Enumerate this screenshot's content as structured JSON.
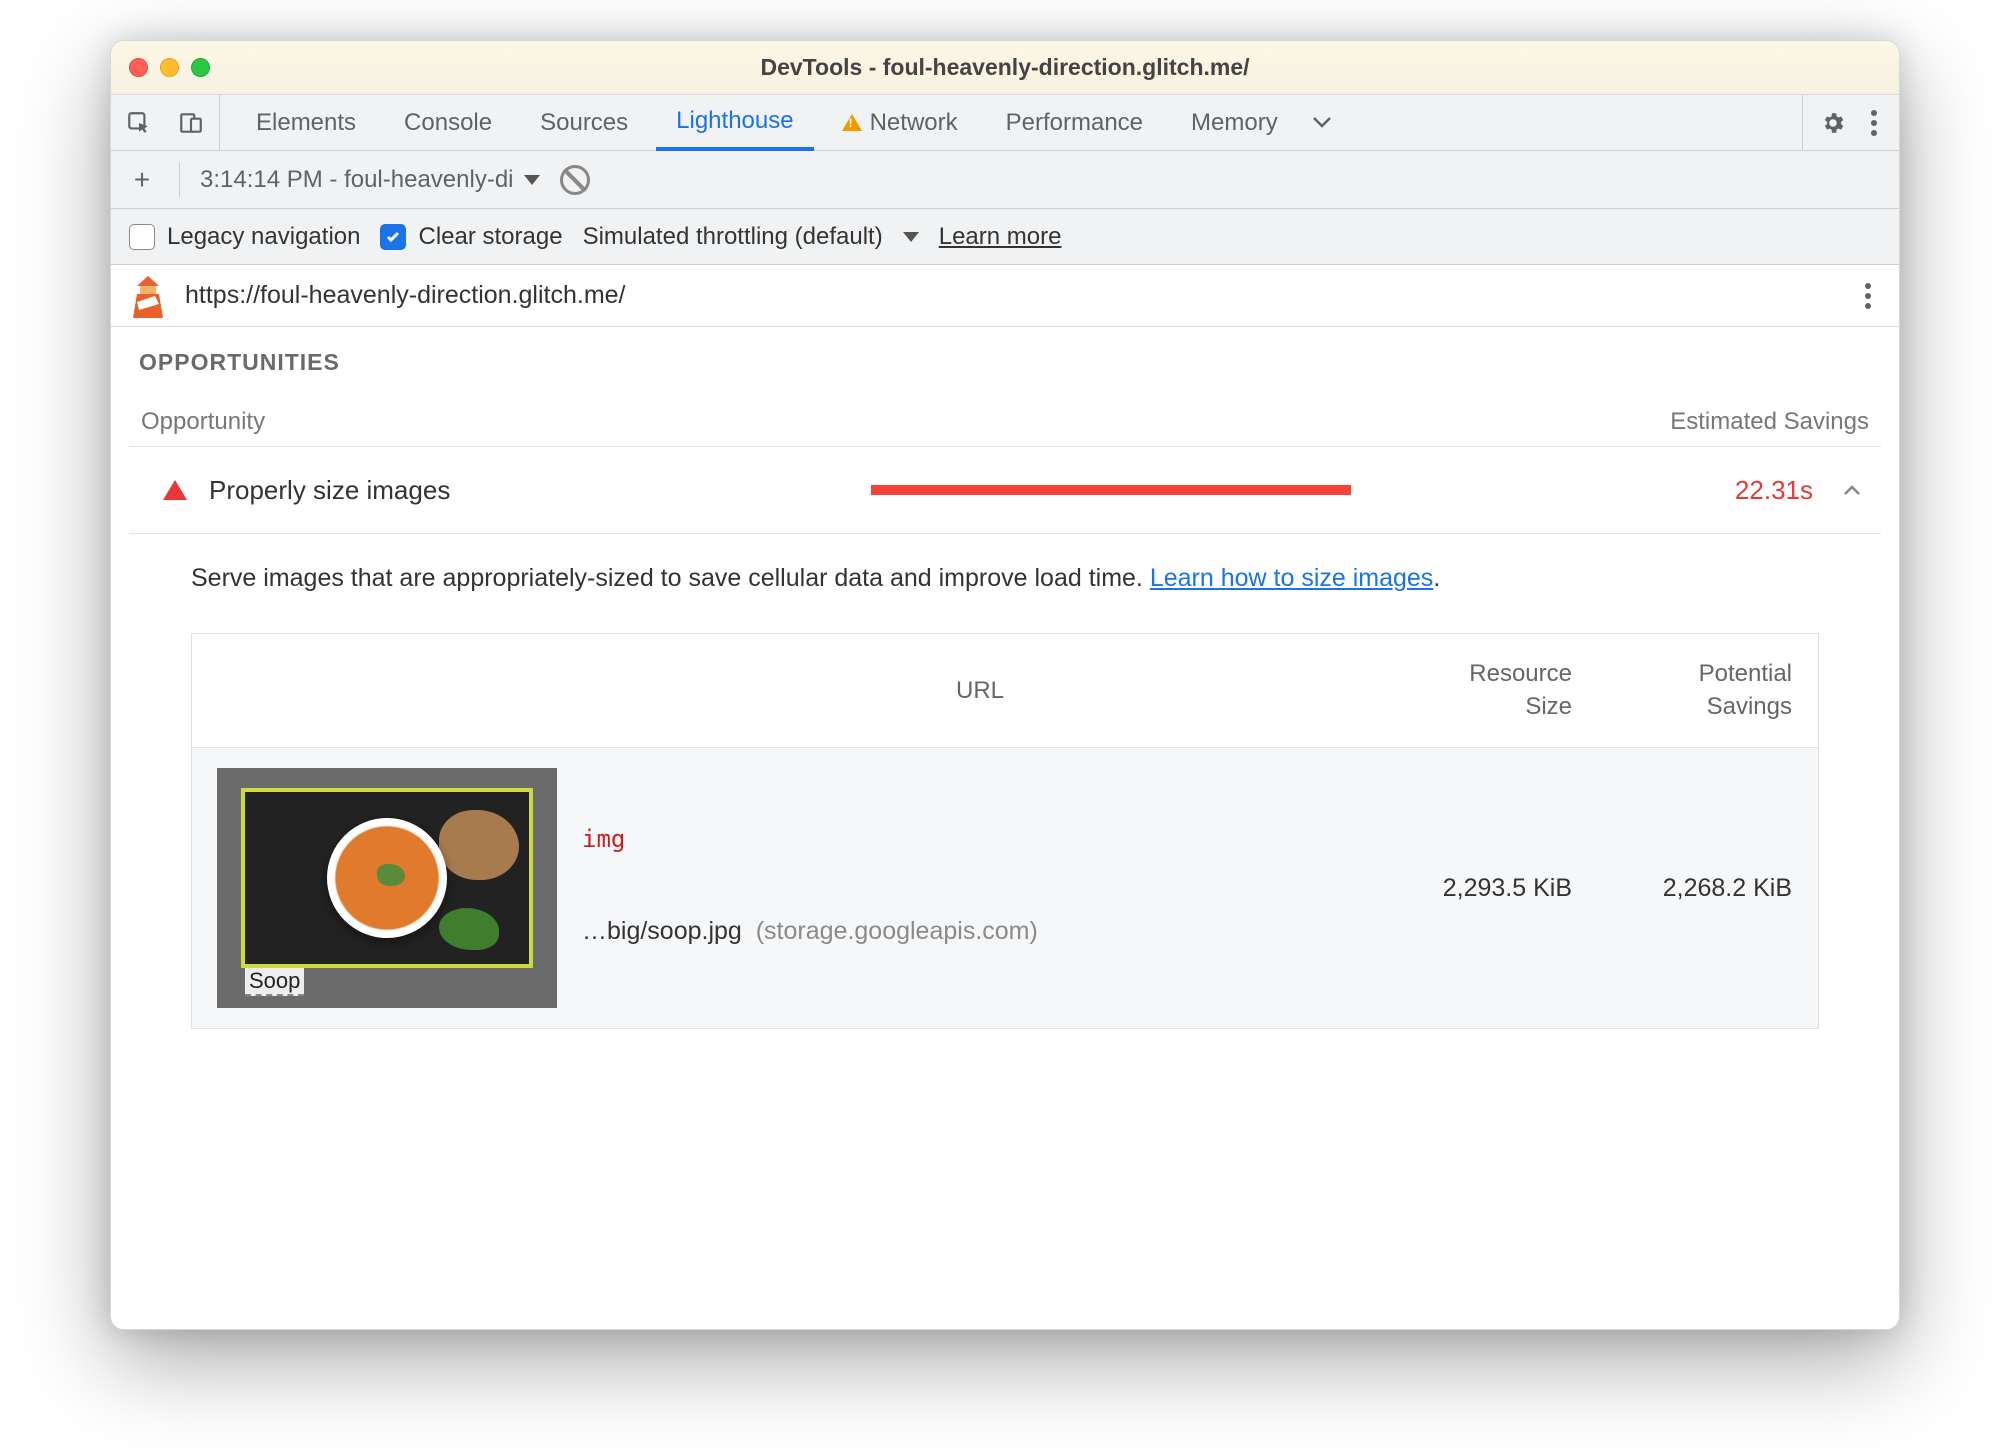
{
  "window": {
    "title": "DevTools - foul-heavenly-direction.glitch.me/"
  },
  "tabs": {
    "items": [
      "Elements",
      "Console",
      "Sources",
      "Lighthouse",
      "Network",
      "Performance",
      "Memory"
    ],
    "active": "Lighthouse",
    "warning_on": "Network"
  },
  "toolbar": {
    "report_label": "3:14:14 PM - foul-heavenly-di"
  },
  "settings": {
    "legacy_label": "Legacy navigation",
    "legacy_checked": false,
    "clear_label": "Clear storage",
    "clear_checked": true,
    "throttling_label": "Simulated throttling (default)",
    "learn_more": "Learn more"
  },
  "urlbar": {
    "url": "https://foul-heavenly-direction.glitch.me/"
  },
  "opportunities": {
    "section_title": "OPPORTUNITIES",
    "col_opportunity": "Opportunity",
    "col_savings": "Estimated Savings",
    "item": {
      "name": "Properly size images",
      "savings": "22.31s",
      "description_pre": "Serve images that are appropriately-sized to save cellular data and improve load time. ",
      "description_link": "Learn how to size images",
      "description_post": "."
    }
  },
  "table": {
    "headers": {
      "url": "URL",
      "size_l1": "Resource",
      "size_l2": "Size",
      "pot_l1": "Potential",
      "pot_l2": "Savings"
    },
    "row": {
      "tag": "img",
      "path": "…big/soop.jpg",
      "host": "(storage.googleapis.com)",
      "size": "2,293.5 KiB",
      "potential": "2,268.2 KiB",
      "thumb_caption": "Soop"
    }
  }
}
